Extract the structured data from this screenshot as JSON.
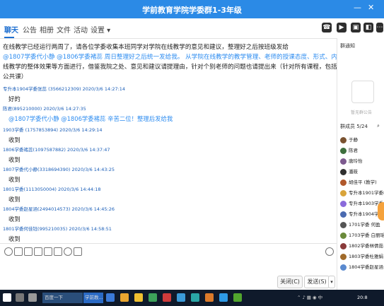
{
  "window": {
    "title": "学前教育学院学委群1-3年级"
  },
  "tabs": [
    {
      "label": "聊天",
      "active": true
    },
    {
      "label": "公告"
    },
    {
      "label": "相册"
    },
    {
      "label": "文件"
    },
    {
      "label": "活动"
    },
    {
      "label": "设置 ▾"
    }
  ],
  "top_icons": [
    "phone-icon",
    "video-icon",
    "screen-icon",
    "app-icon",
    "more-icon"
  ],
  "messages": {
    "announcement_lines": [
      "在线教学已经运行两周了，请各位学委收集本班同学对学院在线教学的意见和建议，整理好之后按班级发给",
      "@1807学委代小静 @1806学委褚蕊 周日整理好之后统一发给我。 从学院在线教学的教学管理、老师的授课态度、形式、内容、作业布置、辅导、在",
      "线教学的整体效果等方面进行，借鉴我院之处、意见和建议请提理由，针对个别老师的问题也请提出来（针对所有课程，包括专业课和外学院开设的",
      "公共课）"
    ],
    "announcement_mentions": [
      "@1807学委代小静",
      "@1806学委褚蕊"
    ],
    "entries": [
      {
        "meta": "专升本1904学委张蕊 (3566212309) 2020/3/6 14:27:14",
        "text": "好的"
      },
      {
        "meta": "陈君(895210000) 2020/3/6 14:27:35",
        "text": "@1807学委代小静 @1806学委褚蕊 辛苦二位！整理后发给我"
      },
      {
        "meta": "1903学委 (1757853894) 2020/3/6 14:29:14",
        "text": "收到"
      },
      {
        "meta": "1806学委褚蕊(1097587882) 2020/3/6 14:37:47",
        "text": "收到"
      },
      {
        "meta": "1807学委代小静(3318694390) 2020/3/6 14:43:25",
        "text": "收到"
      },
      {
        "meta": "1801学委(1113050004) 2020/3/6 14:44:18",
        "text": "收到"
      },
      {
        "meta": "1804学委赵星涵(2494014573) 2020/3/6 14:45:26",
        "text": "收到"
      },
      {
        "meta": "1801学委何佳钰(995210035) 2020/3/6 14:58:51",
        "text": "收到"
      }
    ]
  },
  "input": {
    "close_label": "关闭(C)",
    "send_label": "发送(S)",
    "send_dropdown": "▾"
  },
  "sidebar": {
    "notice_title": "群通知",
    "notice_placeholder": "暂无群公告",
    "members_title": "群成员 5/24",
    "members": [
      {
        "name": "于静",
        "color": "#7a5230"
      },
      {
        "name": "陈君",
        "color": "#3d6f3d"
      },
      {
        "name": "唐玲怡",
        "color": "#7d5a8f"
      },
      {
        "name": "潘筱",
        "color": "#2f2f2f"
      },
      {
        "name": "胡佳平 (教学)",
        "color": "#b0582b"
      },
      {
        "name": "专升本1901学委杨泓",
        "color": "#d9a43a"
      },
      {
        "name": "专升本1903学委 陈",
        "color": "#8a6adb"
      },
      {
        "name": "专升本1904学委",
        "color": "#4a6ab0"
      },
      {
        "name": "1701学委 何盈",
        "color": "#555"
      },
      {
        "name": "1703学委 白丽瑶",
        "color": "#6a8a3a"
      },
      {
        "name": "1802学委林倩茹",
        "color": "#8a3a3a"
      },
      {
        "name": "1803学委杜雅娟",
        "color": "#a06a2a"
      },
      {
        "name": "1804学委赵星涵",
        "color": "#5a8acf"
      }
    ]
  },
  "taskbar": {
    "items": [
      "百度一下",
      "学前教..."
    ],
    "clock": "20:8"
  }
}
